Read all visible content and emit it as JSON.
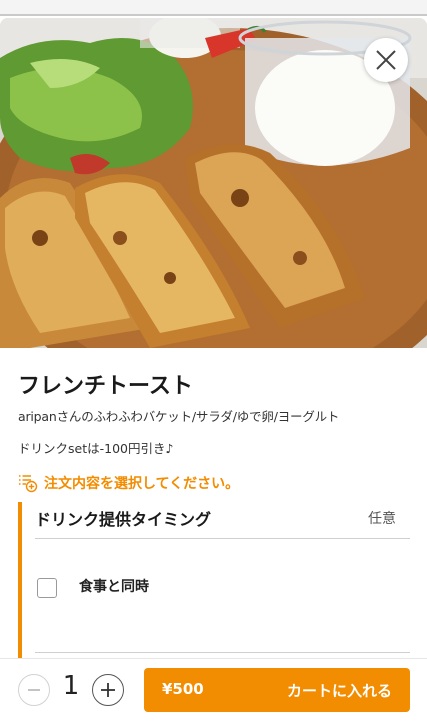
{
  "item": {
    "name": "フレンチトースト",
    "description": "aripanさんのふわふわバケット/サラダ/ゆで卵/ヨーグルト",
    "note": "ドリンクsetは-100円引き♪"
  },
  "prompt": {
    "text": "注文内容を選択してください。",
    "icon": "list-plus-icon"
  },
  "option_group": {
    "title": "ドリンク提供タイミング",
    "badge": "任意",
    "options": [
      {
        "label": "食事と同時",
        "checked": false
      }
    ]
  },
  "footer": {
    "quantity": "1",
    "price": "¥500",
    "add_to_cart_label": "カートに入れる"
  },
  "colors": {
    "accent": "#f28c00",
    "text": "#222222"
  }
}
